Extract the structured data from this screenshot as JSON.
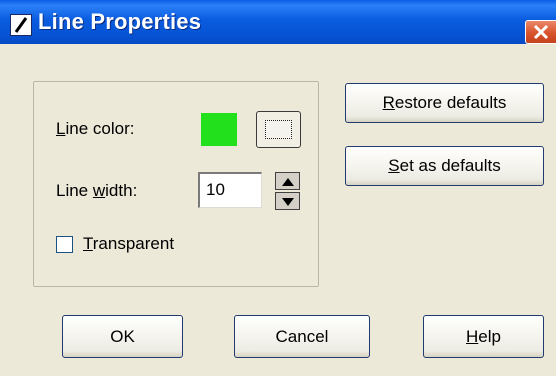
{
  "window": {
    "title": "Line Properties"
  },
  "group": {
    "line_color_label": {
      "pre": "",
      "mnemonic": "L",
      "post": "ine color:"
    },
    "line_color_value": "#22e01c",
    "line_width_label": {
      "pre": "Line ",
      "mnemonic": "w",
      "post": "idth:"
    },
    "line_width_value": "10",
    "transparent_label": {
      "pre": "",
      "mnemonic": "T",
      "post": "ransparent"
    },
    "transparent_checked": false
  },
  "buttons": {
    "restore_defaults": {
      "pre": "",
      "mnemonic": "R",
      "post": "estore defaults"
    },
    "set_as_defaults": {
      "pre": "",
      "mnemonic": "S",
      "post": "et as defaults"
    },
    "ok": "OK",
    "cancel": "Cancel",
    "help": {
      "pre": "",
      "mnemonic": "H",
      "post": "elp"
    }
  },
  "colors": {
    "title_bar": "#0a5ce0",
    "close_button": "#d9532c",
    "dialog_background": "#ece9d8"
  },
  "icons": {
    "title_icon": "line-tool-icon",
    "close": "close-icon",
    "color_picker": "color-picker-icon",
    "spin_up": "arrow-up-icon",
    "spin_down": "arrow-down-icon"
  }
}
